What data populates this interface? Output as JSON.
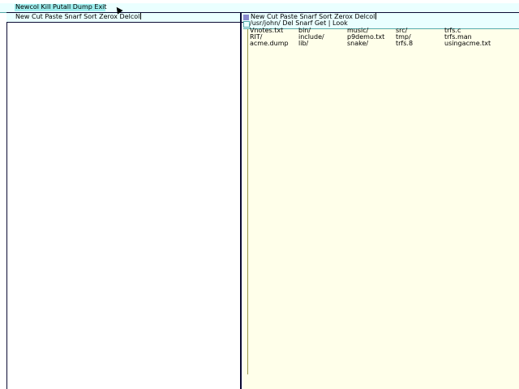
{
  "main_tag": {
    "commands": "Newcol Kill Putall Dump Exit"
  },
  "left_column": {
    "tag": "New Cut Paste Snarf Sort Zerox Delcol"
  },
  "right_column": {
    "tag": "New Cut Paste Snarf Sort Zerox Delcol"
  },
  "window": {
    "tag": "/usr/john/ Del Snarf Get | Look",
    "files": [
      [
        "Vnotes.txt",
        "bin/",
        "music/",
        "src/",
        "trfs.c"
      ],
      [
        "RIT/",
        "include/",
        "p9demo.txt",
        "tmp/",
        "trfs.man"
      ],
      [
        "acme.dump",
        "lib/",
        "snake/",
        "trfs.8",
        "usingacme.txt"
      ]
    ]
  },
  "colors": {
    "tag_bg": "#eaffff",
    "body_bg": "#ffffea",
    "border": "#0a0a33",
    "highlight": "#9eeeee"
  }
}
